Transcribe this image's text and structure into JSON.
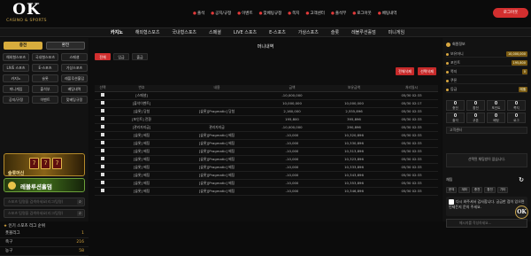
{
  "header": {
    "logo_main": "OK",
    "logo_sub": "CASINO & SPORTS",
    "topnav": [
      "출석",
      "공지/규정",
      "이벤트",
      "맞베팅규정",
      "쪽지",
      "고객센터",
      "출석부",
      "로그아웃",
      "베팅내역"
    ],
    "logout_label": "로그아웃"
  },
  "main_nav": [
    "카지노",
    "해외형스포츠",
    "국내형스포츠",
    "스페셜",
    "LIVE 스포츠",
    "E-스포츠",
    "가상스포츠",
    "슬롯",
    "레볼루션홀덤",
    "미니게임"
  ],
  "left_sidebar": {
    "login_buttons": [
      "충전",
      "환전"
    ],
    "grid": [
      "해외형스포츠",
      "국내형스포츠",
      "스페셜",
      "LIVE 스포츠",
      "E-스포츠",
      "가상스포츠",
      "카지노",
      "슬롯",
      "레볼루션홀덤",
      "미니게임",
      "출석부",
      "베팅내역",
      "공지/규정",
      "이벤트",
      "맞베팅규정"
    ],
    "promo_slot_text": "777",
    "promo_slot_sub": "슬롯머신",
    "promo_revo": "레볼루션홀덤",
    "search_placeholder_1": "스포츠 팀명을 검색하세요(리그/팀명)",
    "search_placeholder_2": "스포츠 팀명을 검색하세요(리그/팀명)",
    "leagues_title": "인기 스포츠 리그 순위",
    "leagues": [
      {
        "name": "풋볼리그",
        "count": "1"
      },
      {
        "name": "축구",
        "count": "216"
      },
      {
        "name": "농구",
        "count": "58"
      }
    ]
  },
  "content": {
    "page_title": "머니내역",
    "tabs": [
      "전체",
      "입금",
      "출금"
    ],
    "red_buttons": [
      "전체삭제",
      "선택삭제"
    ],
    "columns": [
      "선택",
      "번호",
      "내용",
      "금액",
      "보유금액",
      "처리일시"
    ],
    "rows": [
      [
        "[스페셜]",
        "",
        "-10,000,000",
        "",
        "05/30 02:33"
      ],
      [
        "[출석이벤트]",
        "",
        "10,000,000",
        "10,000,000",
        "05/30 02:17"
      ],
      [
        "[슬롯] 당첨",
        "[슬롯][Pragmatic] 당첨",
        "2,160,000",
        "2,555,896",
        "05/30 02:33"
      ],
      [
        "[포인트] 전환",
        "",
        "195,800",
        "395,896",
        "05/30 02:33"
      ],
      [
        "[관리자지급]",
        "관리자지급",
        "-10,000,000",
        "290,896",
        "05/30 02:33"
      ],
      [
        "[슬롯] 베팅",
        "[슬롯][Pragmatic] 베팅",
        "-10,000",
        "10,320,896",
        "05/30 02:33"
      ],
      [
        "[슬롯] 베팅",
        "[슬롯][Pragmatic] 베팅",
        "-10,000",
        "10,330,896",
        "05/30 02:33"
      ],
      [
        "[슬롯] 베팅",
        "[슬롯][Pragmatic] 베팅",
        "-10,000",
        "10,313,896",
        "05/30 02:33"
      ],
      [
        "[슬롯] 베팅",
        "[슬롯][Pragmatic] 베팅",
        "-10,000",
        "10,323,896",
        "05/30 02:33"
      ],
      [
        "[슬롯] 베팅",
        "[슬롯][Pragmatic] 베팅",
        "-10,000",
        "10,333,896",
        "05/30 02:33"
      ],
      [
        "[슬롯] 베팅",
        "[슬롯][Pragmatic] 베팅",
        "-10,000",
        "10,343,896",
        "05/30 02:33"
      ],
      [
        "[슬롯] 베팅",
        "[슬롯][Pragmatic] 베팅",
        "-10,000",
        "10,353,896",
        "05/30 02:33"
      ],
      [
        "[슬롯] 베팅",
        "[슬롯][Pragmatic] 베팅",
        "-10,000",
        "10,346,896",
        "05/30 02:33"
      ]
    ]
  },
  "right_sidebar": {
    "user_label": "회원정보",
    "info_lines": [
      {
        "label": "보유머니",
        "badge": "10,000,000"
      },
      {
        "label": "포인트",
        "badge": "195,800"
      },
      {
        "label": "쪽지",
        "badge": "0"
      },
      {
        "label": "쿠폰",
        "badge": ""
      },
      {
        "label": "등급",
        "badge": "레벨"
      }
    ],
    "grid": [
      {
        "value": "0",
        "label": "충전"
      },
      {
        "value": "0",
        "label": "환전"
      },
      {
        "value": "0",
        "label": "포인트"
      },
      {
        "value": "0",
        "label": "쪽지"
      },
      {
        "value": "0",
        "label": "출석"
      },
      {
        "value": "0",
        "label": "쿠폰"
      },
      {
        "value": "0",
        "label": "베팅"
      },
      {
        "value": "0",
        "label": "로그"
      }
    ],
    "highlight_label": "고객센터",
    "chat_notice": "선택된 채팅방이 없습니다.",
    "chat_bar_label": "채팅",
    "chips": [
      "문의",
      "계좌",
      "충전",
      "환전",
      "기타"
    ],
    "message": "다시 와주셔서 감사합니다. 궁금한 점이 있으면 언제든지 문의 주세요.",
    "input_placeholder": "메시지를 작성하세요..."
  }
}
